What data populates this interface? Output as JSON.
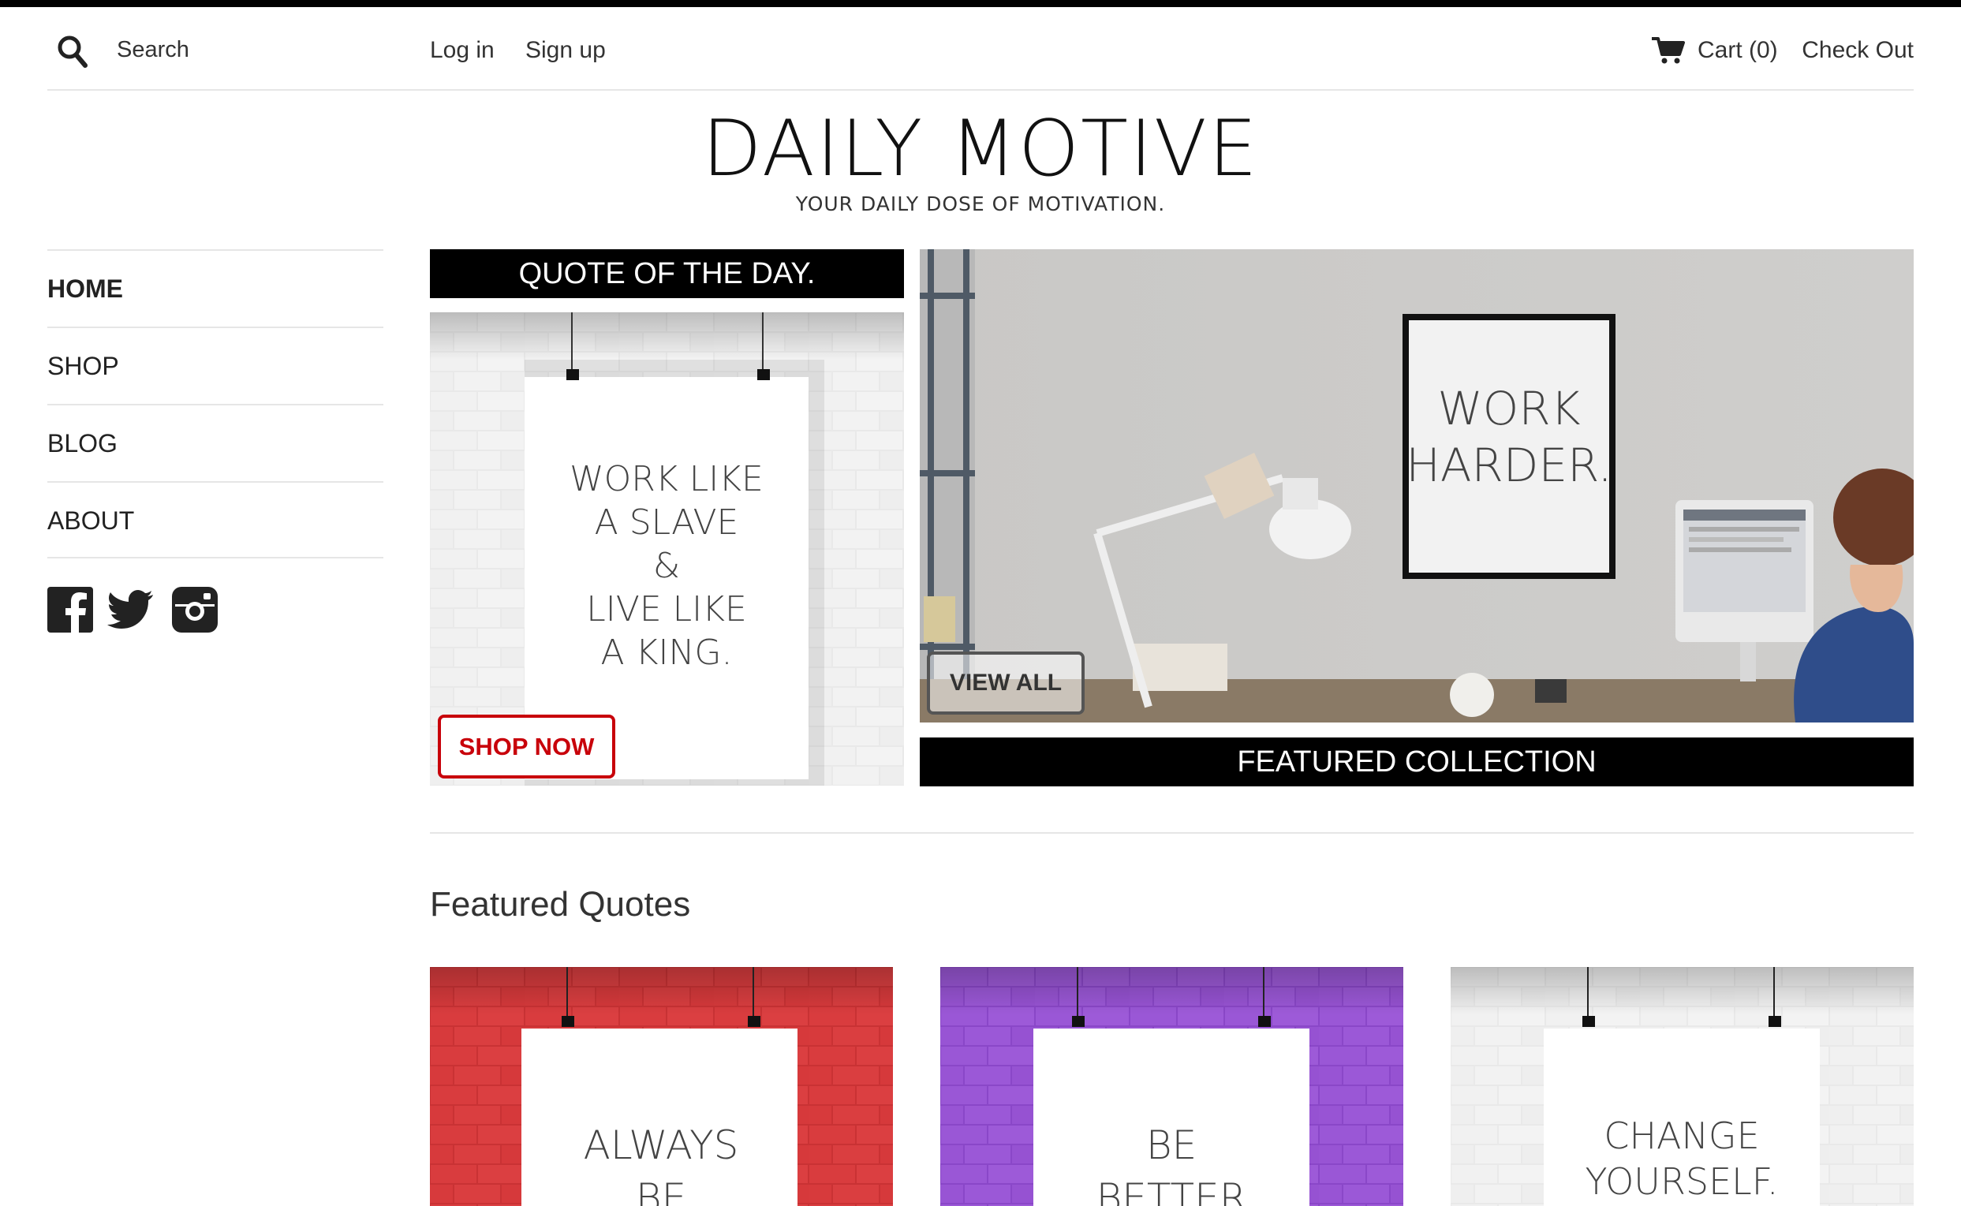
{
  "header": {
    "search_placeholder": "Search",
    "login": "Log in",
    "signup": "Sign up",
    "cart": "Cart (0)",
    "checkout": "Check Out"
  },
  "brand": {
    "title": "DAILY MOTIVE",
    "tagline": "YOUR DAILY DOSE OF MOTIVATION."
  },
  "sidebar": {
    "items": [
      {
        "label": "HOME",
        "active": true
      },
      {
        "label": "SHOP"
      },
      {
        "label": "BLOG"
      },
      {
        "label": "ABOUT"
      }
    ],
    "social_icons": [
      "facebook-icon",
      "twitter-icon",
      "instagram-icon"
    ]
  },
  "quote_of_day": {
    "heading": "QUOTE OF THE DAY.",
    "poster_lines": [
      "WORK LIKE",
      "A SLAVE",
      "&",
      "LIVE LIKE",
      "A KING."
    ],
    "button": "SHOP NOW"
  },
  "featured_collection": {
    "poster_lines": [
      "WORK",
      "HARDER."
    ],
    "button": "VIEW ALL",
    "heading": "FEATURED COLLECTION"
  },
  "featured_quotes": {
    "heading": "Featured Quotes",
    "cards": [
      {
        "wall_color": "#d9393b",
        "poster_lines": [
          "ALWAYS",
          "BE"
        ]
      },
      {
        "wall_color": "#9b57d6",
        "poster_lines": [
          "BE",
          "BETTER"
        ]
      },
      {
        "wall_color": "#ebebeb",
        "poster_lines": [
          "CHANGE",
          "YOURSELF."
        ]
      }
    ]
  },
  "colors": {
    "accent_red": "#c8000a",
    "black": "#000000",
    "rule": "#e6e6e6"
  }
}
